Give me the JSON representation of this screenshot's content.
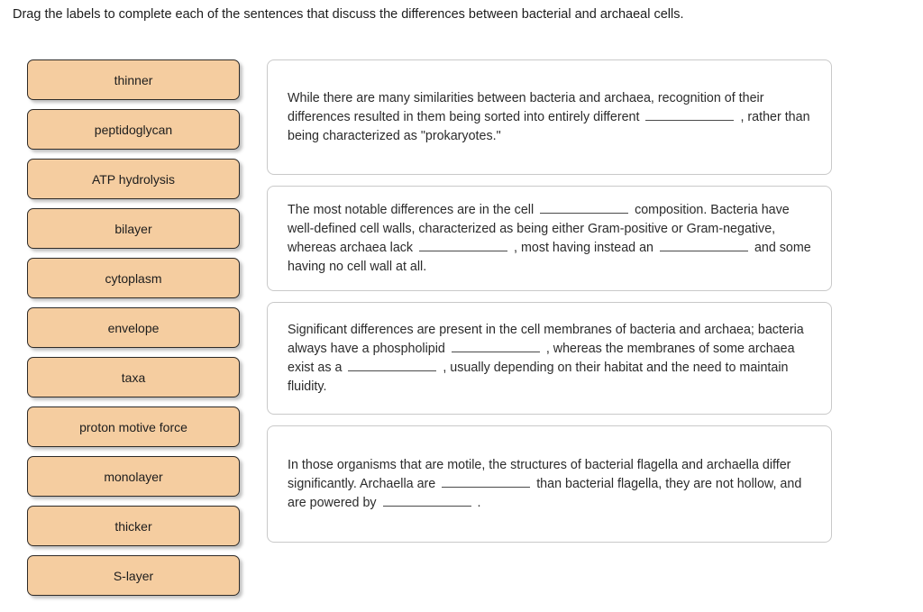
{
  "instruction": "Drag the labels to complete each of the sentences that discuss the differences between bacterial and archaeal cells.",
  "colors": {
    "label_fill": "#f5cda0",
    "label_border": "#2e2b28",
    "panel_border": "#c9c9c9",
    "text": "#2b2b2b",
    "page_background": "#ffffff"
  },
  "label_bank": {
    "name": "draggable-label-bank",
    "items": [
      {
        "label": "thinner"
      },
      {
        "label": "peptidoglycan"
      },
      {
        "label": "ATP hydrolysis"
      },
      {
        "label": "bilayer"
      },
      {
        "label": "cytoplasm"
      },
      {
        "label": "envelope"
      },
      {
        "label": "taxa"
      },
      {
        "label": "proton motive force"
      },
      {
        "label": "monolayer"
      },
      {
        "label": "thicker"
      },
      {
        "label": "S-layer"
      }
    ]
  },
  "panels": [
    {
      "id": "panel-1",
      "segments": [
        {
          "type": "text",
          "value": "While there are many similarities between bacteria and archaea, recognition of their differences resulted in them being sorted into entirely different "
        },
        {
          "type": "blank",
          "value": ""
        },
        {
          "type": "text",
          "value": " , rather than being characterized as \"prokaryotes.\""
        }
      ]
    },
    {
      "id": "panel-2",
      "segments": [
        {
          "type": "text",
          "value": "The most notable differences are in the cell "
        },
        {
          "type": "blank",
          "value": ""
        },
        {
          "type": "text",
          "value": " composition. Bacteria have well-defined cell walls, characterized as being either Gram-positive or Gram-negative, whereas archaea lack "
        },
        {
          "type": "blank",
          "value": ""
        },
        {
          "type": "text",
          "value": " , most having instead an "
        },
        {
          "type": "blank",
          "value": ""
        },
        {
          "type": "text",
          "value": " and some having no cell wall at all."
        }
      ]
    },
    {
      "id": "panel-3",
      "segments": [
        {
          "type": "text",
          "value": "Significant differences are present in the cell membranes of bacteria and archaea; bacteria always have a phospholipid "
        },
        {
          "type": "blank",
          "value": ""
        },
        {
          "type": "text",
          "value": " , whereas the membranes of some archaea exist as a "
        },
        {
          "type": "blank",
          "value": ""
        },
        {
          "type": "text",
          "value": " , usually depending on their habitat and the need to maintain fluidity."
        }
      ]
    },
    {
      "id": "panel-4",
      "segments": [
        {
          "type": "text",
          "value": "In those organisms that are motile, the structures of bacterial flagella and archaella differ significantly. Archaella are "
        },
        {
          "type": "blank",
          "value": ""
        },
        {
          "type": "text",
          "value": " than bacterial flagella, they are not hollow, and are powered by "
        },
        {
          "type": "blank",
          "value": ""
        },
        {
          "type": "text",
          "value": " ."
        }
      ]
    }
  ]
}
